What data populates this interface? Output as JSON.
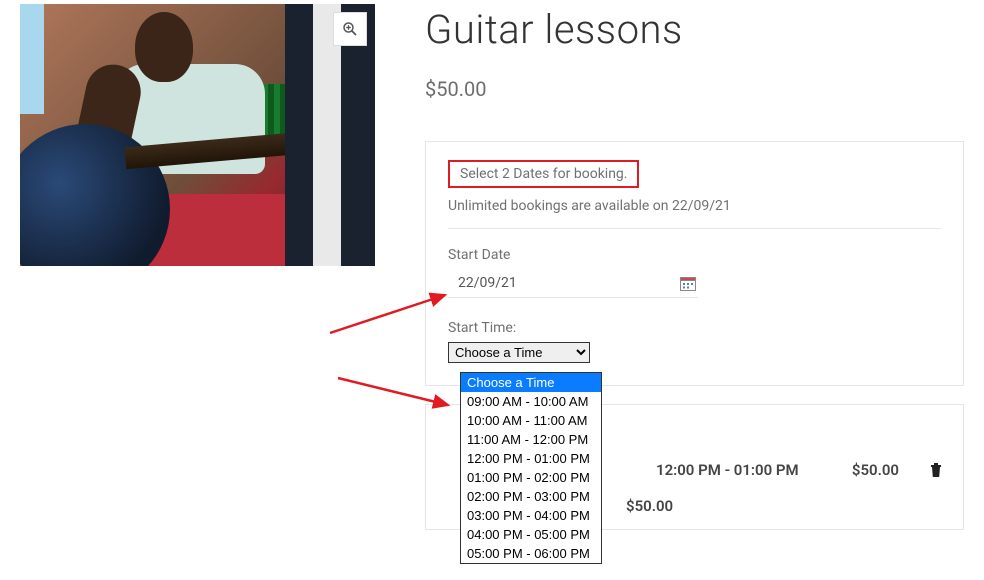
{
  "product": {
    "title": "Guitar lessons",
    "price": "$50.00"
  },
  "booking": {
    "select_dates_label": "Select 2 Dates for booking.",
    "availability_text": "Unlimited bookings are available on 22/09/21",
    "start_date_label": "Start Date",
    "start_date_value": "22/09/21",
    "start_time_label": "Start Time:",
    "time_select_display": "Choose a Time",
    "time_options": [
      "Choose a Time",
      "09:00 AM - 10:00 AM",
      "10:00 AM - 11:00 AM",
      "11:00 AM - 12:00 PM",
      "12:00 PM - 01:00 PM",
      "01:00 PM - 02:00 PM",
      "02:00 PM - 03:00 PM",
      "03:00 PM - 04:00 PM",
      "04:00 PM - 05:00 PM",
      "05:00 PM - 06:00 PM"
    ],
    "selected_option_index": 0
  },
  "summary": {
    "row_time": "12:00 PM - 01:00 PM",
    "row_price": "$50.00",
    "total": "$50.00"
  },
  "icons": {
    "zoom": "search-plus-icon",
    "calendar": "calendar-icon",
    "trash": "trash-icon"
  }
}
